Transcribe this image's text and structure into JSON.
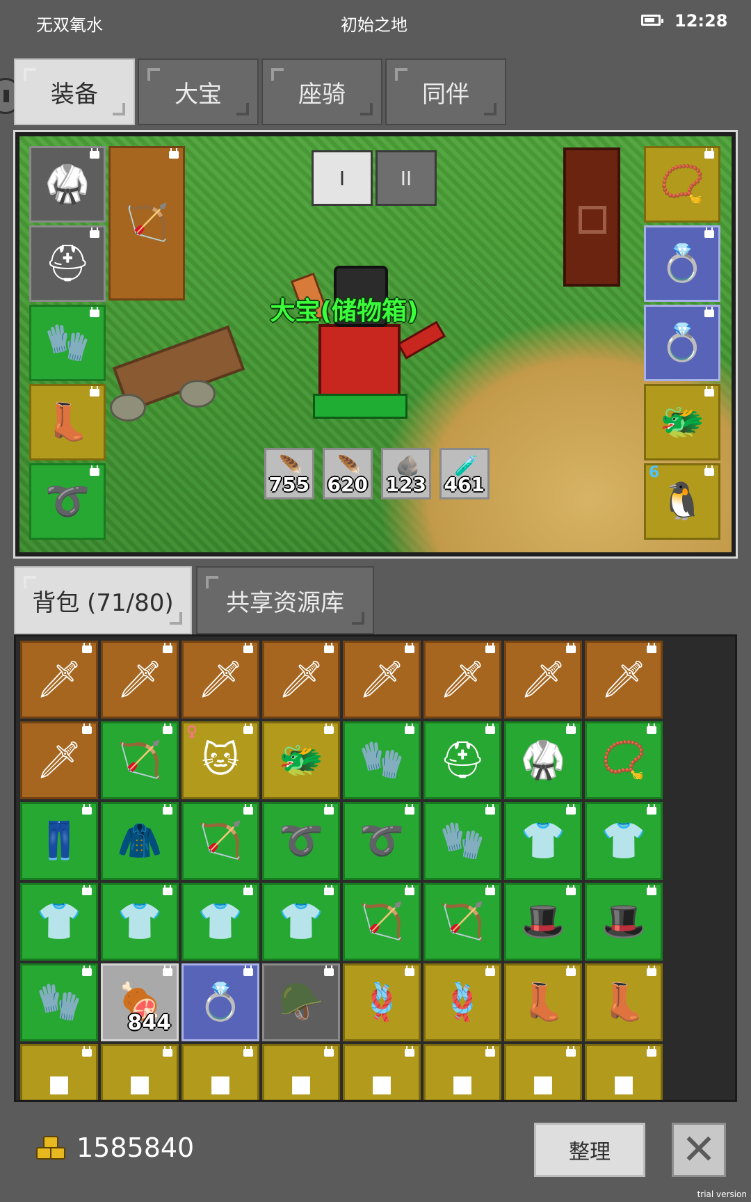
{
  "status_bar": {
    "carrier": "无双氧水",
    "location": "初始之地",
    "time": "12:28"
  },
  "top_tabs": [
    {
      "label": "装备",
      "active": true
    },
    {
      "label": "大宝",
      "active": false
    },
    {
      "label": "座骑",
      "active": false
    },
    {
      "label": "同伴",
      "active": false
    }
  ],
  "preview": {
    "page_buttons": [
      {
        "label": "I",
        "active": true
      },
      {
        "label": "II",
        "active": false
      }
    ],
    "character_name": "大宝(储物箱)",
    "resources": [
      {
        "icon": "blue-feather-icon",
        "value": "755"
      },
      {
        "icon": "red-feather-icon",
        "value": "620"
      },
      {
        "icon": "teal-ore-icon",
        "value": "123"
      },
      {
        "icon": "potion-bottles-icon",
        "value": "461"
      }
    ],
    "left_slots": [
      {
        "icon": "dark-armor-icon",
        "quality": "gray"
      },
      {
        "icon": "dark-helmet-icon",
        "quality": "gray"
      },
      {
        "icon": "blue-gauntlet-icon",
        "quality": "green"
      },
      {
        "icon": "dark-boots-icon",
        "quality": "olive"
      },
      {
        "icon": "blue-belt-icon",
        "quality": "green"
      }
    ],
    "weapon_slot": {
      "icon": "red-bow-icon",
      "quality": "brown"
    },
    "right_slots": [
      {
        "icon": "horned-amulet-icon",
        "quality": "olive"
      },
      {
        "icon": "purple-ring-icon",
        "quality": "blue"
      },
      {
        "icon": "red-ring-icon",
        "quality": "blue"
      },
      {
        "icon": "dragon-helm-icon",
        "quality": "olive"
      },
      {
        "icon": "bird-pet-icon",
        "quality": "olive"
      }
    ]
  },
  "bag_tabs": [
    {
      "label": "背包 (71/80)",
      "active": true
    },
    {
      "label": "共享资源库",
      "active": false
    }
  ],
  "inventory": [
    {
      "icon": "golden-sword-icon",
      "quality": "brown"
    },
    {
      "icon": "golden-sword-icon",
      "quality": "brown"
    },
    {
      "icon": "golden-sword-icon",
      "quality": "brown"
    },
    {
      "icon": "golden-sword-icon",
      "quality": "brown"
    },
    {
      "icon": "golden-sword-icon",
      "quality": "brown"
    },
    {
      "icon": "golden-sword-icon",
      "quality": "brown"
    },
    {
      "icon": "golden-sword-icon",
      "quality": "brown"
    },
    {
      "icon": "golden-sword-icon",
      "quality": "brown"
    },
    {
      "icon": "golden-sword-icon",
      "quality": "brown"
    },
    {
      "icon": "ice-bow-icon",
      "quality": "green"
    },
    {
      "icon": "cat-mask-icon",
      "quality": "olive",
      "female": true
    },
    {
      "icon": "dragon-helm-icon",
      "quality": "olive"
    },
    {
      "icon": "steel-gauntlet-icon",
      "quality": "green"
    },
    {
      "icon": "spiked-helmet-icon",
      "quality": "green"
    },
    {
      "icon": "dark-armor-icon",
      "quality": "green"
    },
    {
      "icon": "horned-amulet-icon",
      "quality": "green"
    },
    {
      "icon": "steel-greaves-icon",
      "quality": "green"
    },
    {
      "icon": "black-robe-icon",
      "quality": "green"
    },
    {
      "icon": "dark-bow-icon",
      "quality": "green"
    },
    {
      "icon": "blue-belt-icon",
      "quality": "green"
    },
    {
      "icon": "blue-belt-icon",
      "quality": "green"
    },
    {
      "icon": "blue-gauntlet-icon",
      "quality": "green"
    },
    {
      "icon": "blue-chainmail-icon",
      "quality": "green"
    },
    {
      "icon": "blue-chainmail-icon",
      "quality": "green"
    },
    {
      "icon": "blue-chainmail-icon",
      "quality": "green"
    },
    {
      "icon": "blue-chainmail-icon",
      "quality": "green"
    },
    {
      "icon": "blue-chainmail-icon",
      "quality": "green"
    },
    {
      "icon": "blue-chainmail-icon",
      "quality": "green"
    },
    {
      "icon": "ice-bow-icon",
      "quality": "green"
    },
    {
      "icon": "ice-bow-icon",
      "quality": "green"
    },
    {
      "icon": "purple-hat-icon",
      "quality": "green"
    },
    {
      "icon": "purple-hat-icon",
      "quality": "green"
    },
    {
      "icon": "purple-glove-icon",
      "quality": "green"
    },
    {
      "icon": "meat-icon",
      "quality": "light",
      "qty": "844"
    },
    {
      "icon": "green-ring-icon",
      "quality": "blue"
    },
    {
      "icon": "horned-helmet-icon",
      "quality": "gray"
    },
    {
      "icon": "coiled-rope-icon",
      "quality": "olive"
    },
    {
      "icon": "coiled-rope-icon",
      "quality": "olive"
    },
    {
      "icon": "dark-boots-icon",
      "quality": "olive"
    },
    {
      "icon": "dark-boots-icon",
      "quality": "olive"
    },
    {
      "icon": "unknown-item-icon",
      "quality": "olive"
    },
    {
      "icon": "unknown-item-icon",
      "quality": "olive"
    },
    {
      "icon": "unknown-item-icon",
      "quality": "olive"
    },
    {
      "icon": "unknown-item-icon",
      "quality": "olive"
    },
    {
      "icon": "unknown-item-icon",
      "quality": "olive"
    },
    {
      "icon": "unknown-item-icon",
      "quality": "olive"
    },
    {
      "icon": "unknown-item-icon",
      "quality": "olive"
    },
    {
      "icon": "unknown-item-icon",
      "quality": "olive"
    }
  ],
  "footer": {
    "gold": "1585840",
    "sort_label": "整理",
    "close_icon": "close-x-icon"
  },
  "watermark": "trial version",
  "colors": {
    "background": "#5b5b5b",
    "quality_brown": "#a6661f",
    "quality_green": "#27a832",
    "quality_olive": "#b29a1c",
    "quality_blue": "#5864b8",
    "quality_gray": "#5e5e5e",
    "quality_light": "#a9a9a9",
    "name_label": "#3cff3c"
  }
}
